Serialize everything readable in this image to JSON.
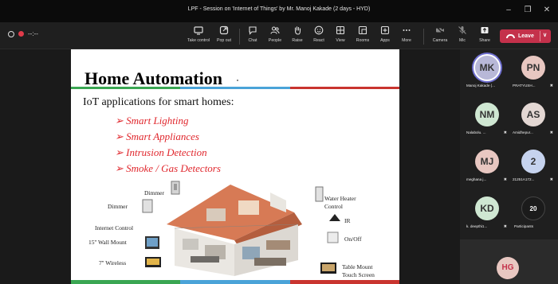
{
  "window": {
    "title": "LPF - Session on 'Internet of Things' by Mr. Manoj Kakade (2 days - HYD)",
    "minimize": "–",
    "maximize": "❐",
    "close": "✕"
  },
  "recording": {
    "timer": "--:--"
  },
  "toolbar": {
    "take_control": "Take control",
    "pop_out": "Pop out",
    "chat": "Chat",
    "people": "People",
    "raise": "Raise",
    "react": "React",
    "view": "View",
    "rooms": "Rooms",
    "apps": "Apps",
    "more": "More",
    "camera": "Camera",
    "mic": "Mic",
    "share": "Share",
    "leave": "Leave"
  },
  "slide": {
    "title": "Home Automation",
    "subtitle": "IoT applications for smart homes:",
    "bullets": [
      "➢ Smart Lighting",
      "➢ Smart Appliances",
      "➢ Intrusion Detection",
      "➢ Smoke / Gas Detectors"
    ],
    "labels": {
      "dimmer1": "Dimmer",
      "dimmer2": "Dimmer",
      "internet": "Internet Control",
      "wall": "15'' Wall Mount",
      "wireless": "7'' Wireless",
      "water1": "Water Heater",
      "water2": "Control",
      "ir": "IR",
      "onoff": "On/Off",
      "table1": "Table Mount",
      "table2": "Touch Screen"
    },
    "colors": {
      "bar": [
        "#3aa652",
        "#4aa3d8",
        "#c9342f"
      ]
    }
  },
  "participants": [
    {
      "initials": "MK",
      "name": "Manoj Kakade (...",
      "color": "#b8b8d8",
      "mic": "",
      "active": true
    },
    {
      "initials": "PN",
      "name": "PRATYUSH...",
      "color": "#e8c7c1",
      "mic": "✖"
    },
    {
      "initials": "NM",
      "name": "Nalabolu. ...",
      "color": "#cfe7d2",
      "mic": "✖"
    },
    {
      "initials": "AS",
      "name": "Amidhepur...",
      "color": "#e3d7d3",
      "mic": "✖"
    },
    {
      "initials": "MJ",
      "name": "meghana j...",
      "color": "#e8c7c1",
      "mic": "✖"
    },
    {
      "initials": "2",
      "name": "21251A172...",
      "color": "#c6d3ee",
      "mic": "✖"
    },
    {
      "initials": "KD",
      "name": "k. deepthi1...",
      "color": "#cfe7d2",
      "mic": "✖"
    },
    {
      "initials": "20",
      "name": "Participants",
      "color": "#1b1b1b",
      "mic": ""
    }
  ],
  "featured": {
    "initials": "HG",
    "color": "#e8c7c1"
  }
}
